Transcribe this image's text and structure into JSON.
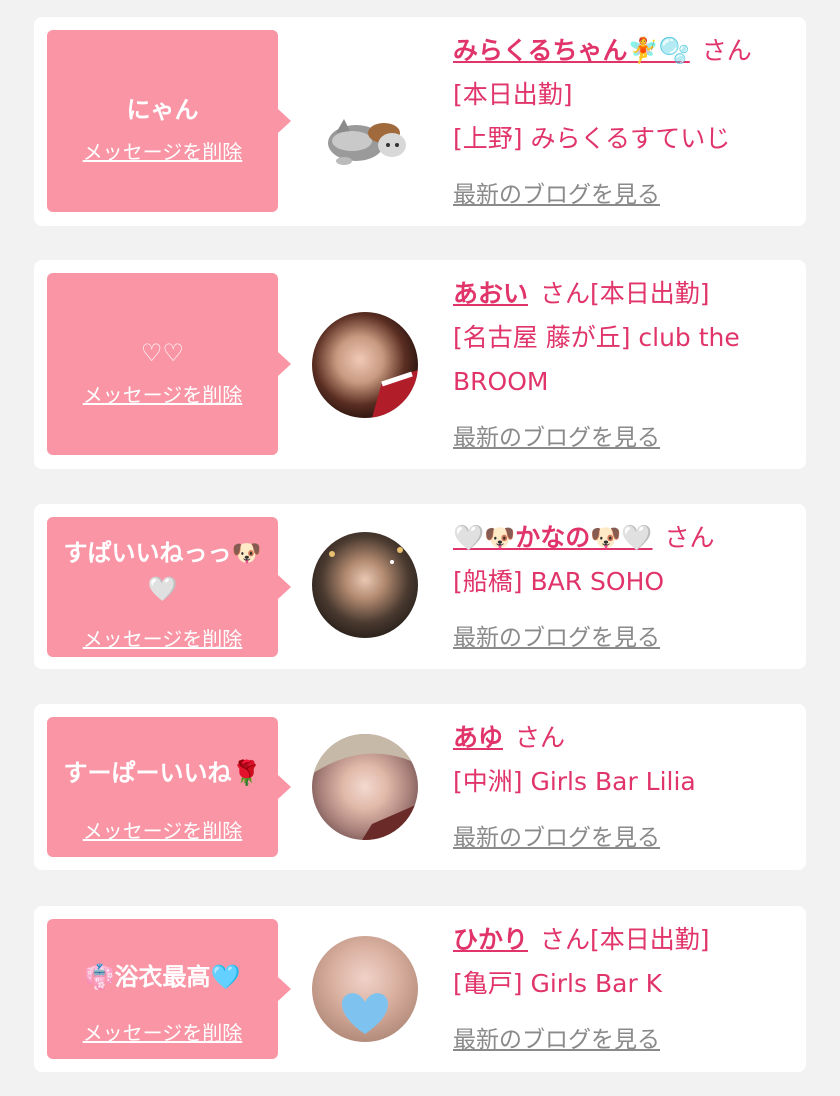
{
  "colors": {
    "page_bg": "#f2f2f2",
    "card_bg": "#ffffff",
    "bubble": "#f995a4",
    "accent_text": "#e0346a",
    "link_gray": "#8a8a8a"
  },
  "cards": [
    {
      "message": "にゃん",
      "delete_label": "メッセージを削除",
      "name": "みらくるちゃん🧚🫧",
      "honorific_status": "さん[本日出勤]",
      "shop": "[上野] みらくるすていじ",
      "blog_label": "最新のブログを見る",
      "avatar_icon": "cat-icon"
    },
    {
      "message": "♡♡",
      "delete_label": "メッセージを削除",
      "name": "あおい",
      "honorific_status": "さん[本日出勤]",
      "shop": "[名古屋 藤が丘] club the BROOM",
      "blog_label": "最新のブログを見る",
      "avatar_icon": "profile-photo"
    },
    {
      "message": "すぱいいねっっ🐶🤍",
      "delete_label": "メッセージを削除",
      "name": "🤍🐶かなの🐶🤍",
      "honorific_status": "さん",
      "shop": "[船橋] BAR SOHO",
      "blog_label": "最新のブログを見る",
      "avatar_icon": "profile-photo"
    },
    {
      "message": "すーぱーいいね🌹",
      "delete_label": "メッセージを削除",
      "name": "あゆ",
      "honorific_status": "さん",
      "shop": "[中洲] Girls Bar Lilia",
      "blog_label": "最新のブログを見る",
      "avatar_icon": "profile-photo"
    },
    {
      "message": "👘浴衣最高🩵",
      "delete_label": "メッセージを削除",
      "name": "ひかり",
      "honorific_status": "さん[本日出勤]",
      "shop": "[亀戸] Girls Bar K",
      "blog_label": "最新のブログを見る",
      "avatar_icon": "profile-photo"
    }
  ]
}
